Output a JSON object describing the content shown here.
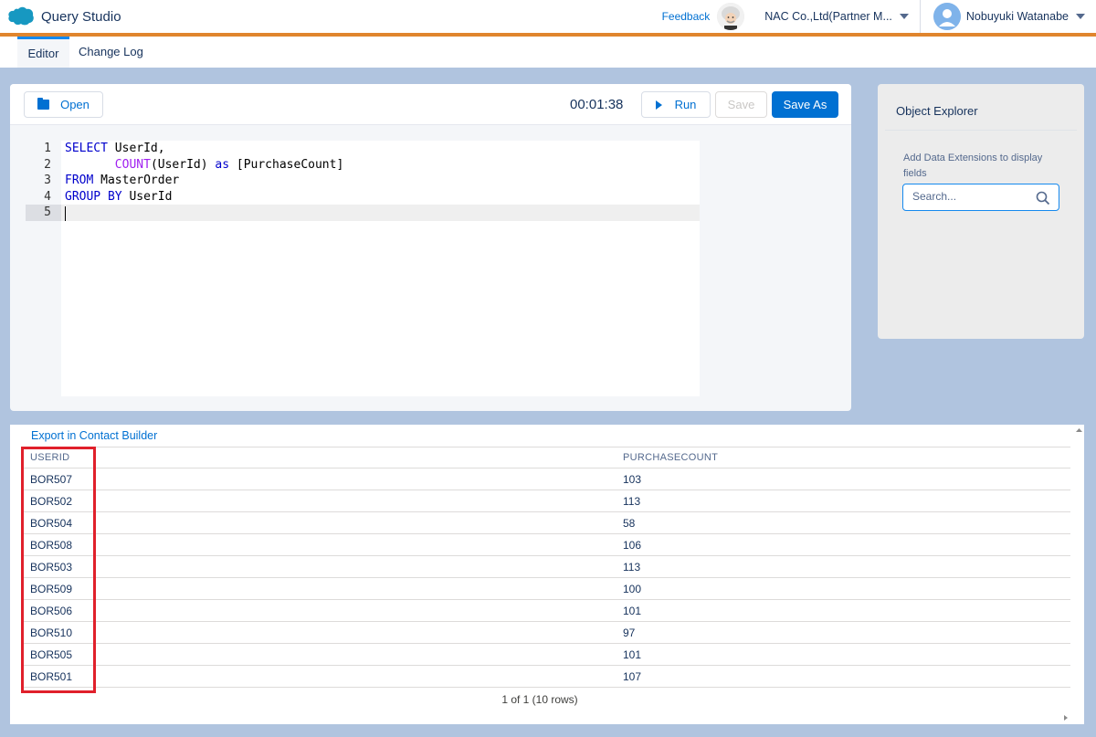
{
  "header": {
    "app_name": "Query Studio",
    "feedback": "Feedback",
    "org": "NAC Co.,Ltd(Partner M...",
    "user": "Nobuyuki Watanabe"
  },
  "tabs": [
    {
      "label": "Editor",
      "active": true
    },
    {
      "label": "Change Log",
      "active": false
    }
  ],
  "toolbar": {
    "open_label": "Open",
    "timer": "00:01:38",
    "run_label": "Run",
    "save_label": "Save",
    "save_as_label": "Save As"
  },
  "editor": {
    "line_numbers": [
      "1",
      "2",
      "3",
      "4",
      "5"
    ],
    "lines": [
      "SELECT UserId,",
      "       COUNT(UserId) as [PurchaseCount]",
      "FROM MasterOrder",
      "GROUP BY UserId",
      ""
    ],
    "active_line": 5
  },
  "explorer": {
    "title": "Object Explorer",
    "hint": "Add Data Extensions to display fields",
    "search_placeholder": "Search..."
  },
  "results": {
    "export_label": "Export in Contact Builder",
    "columns": [
      "USERID",
      "PURCHASECOUNT"
    ],
    "rows": [
      [
        "BOR507",
        "103"
      ],
      [
        "BOR502",
        "113"
      ],
      [
        "BOR504",
        "58"
      ],
      [
        "BOR508",
        "106"
      ],
      [
        "BOR503",
        "113"
      ],
      [
        "BOR509",
        "100"
      ],
      [
        "BOR506",
        "101"
      ],
      [
        "BOR510",
        "97"
      ],
      [
        "BOR505",
        "101"
      ],
      [
        "BOR501",
        "107"
      ]
    ],
    "pager": "1 of 1 (10 rows)"
  },
  "colors": {
    "accent": "#0070d2",
    "header_rule": "#e0852d",
    "highlight": "#e0202b",
    "background": "#b0c4df"
  },
  "icons": [
    "salesforce-cloud-icon",
    "einstein-icon",
    "caret-down-icon",
    "user-avatar-icon",
    "folder-icon",
    "play-icon",
    "search-icon"
  ]
}
